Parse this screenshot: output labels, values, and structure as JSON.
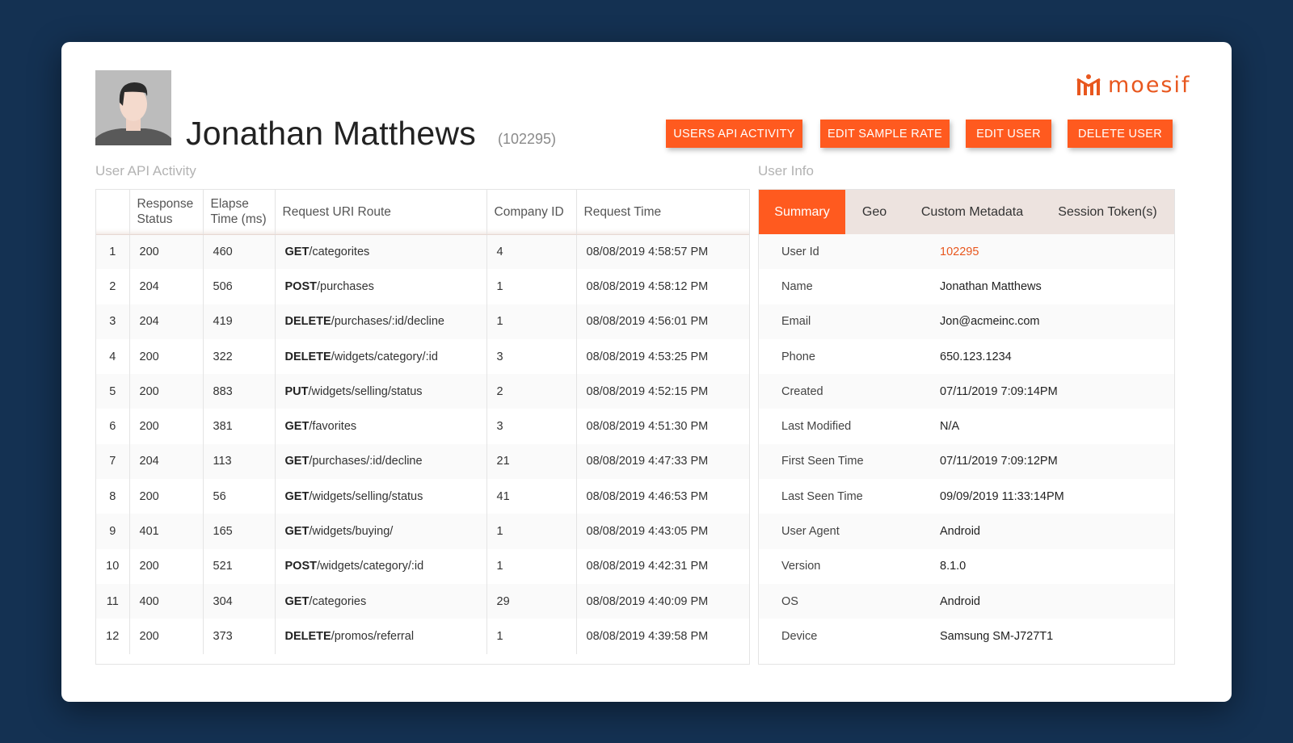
{
  "header": {
    "name": "Jonathan Matthews",
    "id": "(102295)",
    "logo_text": "moesif"
  },
  "buttons": {
    "activity": "USERS API ACTIVITY",
    "sample_rate": "EDIT SAMPLE RATE",
    "edit_user": "EDIT USER",
    "delete_user": "DELETE USER"
  },
  "sections": {
    "activity_title": "User API Activity",
    "info_title": "User Info"
  },
  "activity": {
    "columns": {
      "response_status": "Response Status",
      "elapse_time": "Elapse Time (ms)",
      "route": "Request URI Route",
      "company_id": "Company ID",
      "request_time": "Request Time"
    },
    "rows": [
      {
        "idx": "1",
        "status": "200",
        "time": "460",
        "method": "GET",
        "path": "/categorites",
        "company": "4",
        "request_time": "08/08/2019 4:58:57 PM"
      },
      {
        "idx": "2",
        "status": "204",
        "time": "506",
        "method": "POST",
        "path": "/purchases",
        "company": "1",
        "request_time": "08/08/2019 4:58:12 PM"
      },
      {
        "idx": "3",
        "status": "204",
        "time": "419",
        "method": "DELETE",
        "path": "/purchases/:id/decline",
        "company": "1",
        "request_time": "08/08/2019 4:56:01 PM"
      },
      {
        "idx": "4",
        "status": "200",
        "time": "322",
        "method": "DELETE",
        "path": "/widgets/category/:id",
        "company": "3",
        "request_time": "08/08/2019 4:53:25 PM"
      },
      {
        "idx": "5",
        "status": "200",
        "time": "883",
        "method": "PUT",
        "path": "/widgets/selling/status",
        "company": "2",
        "request_time": "08/08/2019 4:52:15 PM"
      },
      {
        "idx": "6",
        "status": "200",
        "time": "381",
        "method": "GET",
        "path": "/favorites",
        "company": "3",
        "request_time": "08/08/2019 4:51:30 PM"
      },
      {
        "idx": "7",
        "status": "204",
        "time": "113",
        "method": "GET",
        "path": "/purchases/:id/decline",
        "company": "21",
        "request_time": "08/08/2019 4:47:33 PM"
      },
      {
        "idx": "8",
        "status": "200",
        "time": "56",
        "method": "GET",
        "path": "/widgets/selling/status",
        "company": "41",
        "request_time": "08/08/2019 4:46:53 PM"
      },
      {
        "idx": "9",
        "status": "401",
        "time": "165",
        "method": "GET",
        "path": "/widgets/buying/",
        "company": "1",
        "request_time": "08/08/2019 4:43:05 PM"
      },
      {
        "idx": "10",
        "status": "200",
        "time": "521",
        "method": "POST",
        "path": "/widgets/category/:id",
        "company": "1",
        "request_time": "08/08/2019 4:42:31 PM"
      },
      {
        "idx": "11",
        "status": "400",
        "time": "304",
        "method": "GET",
        "path": "/categories",
        "company": "29",
        "request_time": "08/08/2019 4:40:09 PM"
      },
      {
        "idx": "12",
        "status": "200",
        "time": "373",
        "method": "DELETE",
        "path": "/promos/referral",
        "company": "1",
        "request_time": "08/08/2019 4:39:58 PM"
      }
    ]
  },
  "info": {
    "tabs": [
      {
        "label": "Summary",
        "active": true
      },
      {
        "label": "Geo",
        "active": false
      },
      {
        "label": "Custom Metadata",
        "active": false
      },
      {
        "label": "Session Token(s)",
        "active": false
      }
    ],
    "rows": [
      {
        "label": "User Id",
        "value": "102295",
        "link": true
      },
      {
        "label": "Name",
        "value": "Jonathan Matthews"
      },
      {
        "label": "Email",
        "value": "Jon@acmeinc.com"
      },
      {
        "label": "Phone",
        "value": "650.123.1234"
      },
      {
        "label": "Created",
        "value": "07/11/2019 7:09:14PM"
      },
      {
        "label": "Last Modified",
        "value": "N/A"
      },
      {
        "label": "First Seen Time",
        "value": "07/11/2019 7:09:12PM"
      },
      {
        "label": "Last Seen Time",
        "value": "09/09/2019 11:33:14PM"
      },
      {
        "label": "User Agent",
        "value": "Android"
      },
      {
        "label": "Version",
        "value": "8.1.0"
      },
      {
        "label": "OS",
        "value": "Android"
      },
      {
        "label": "Device",
        "value": "Samsung SM-J727T1"
      }
    ]
  },
  "colors": {
    "accent": "#ff5a1f",
    "error_text": "#e8571e",
    "background": "#143152"
  }
}
